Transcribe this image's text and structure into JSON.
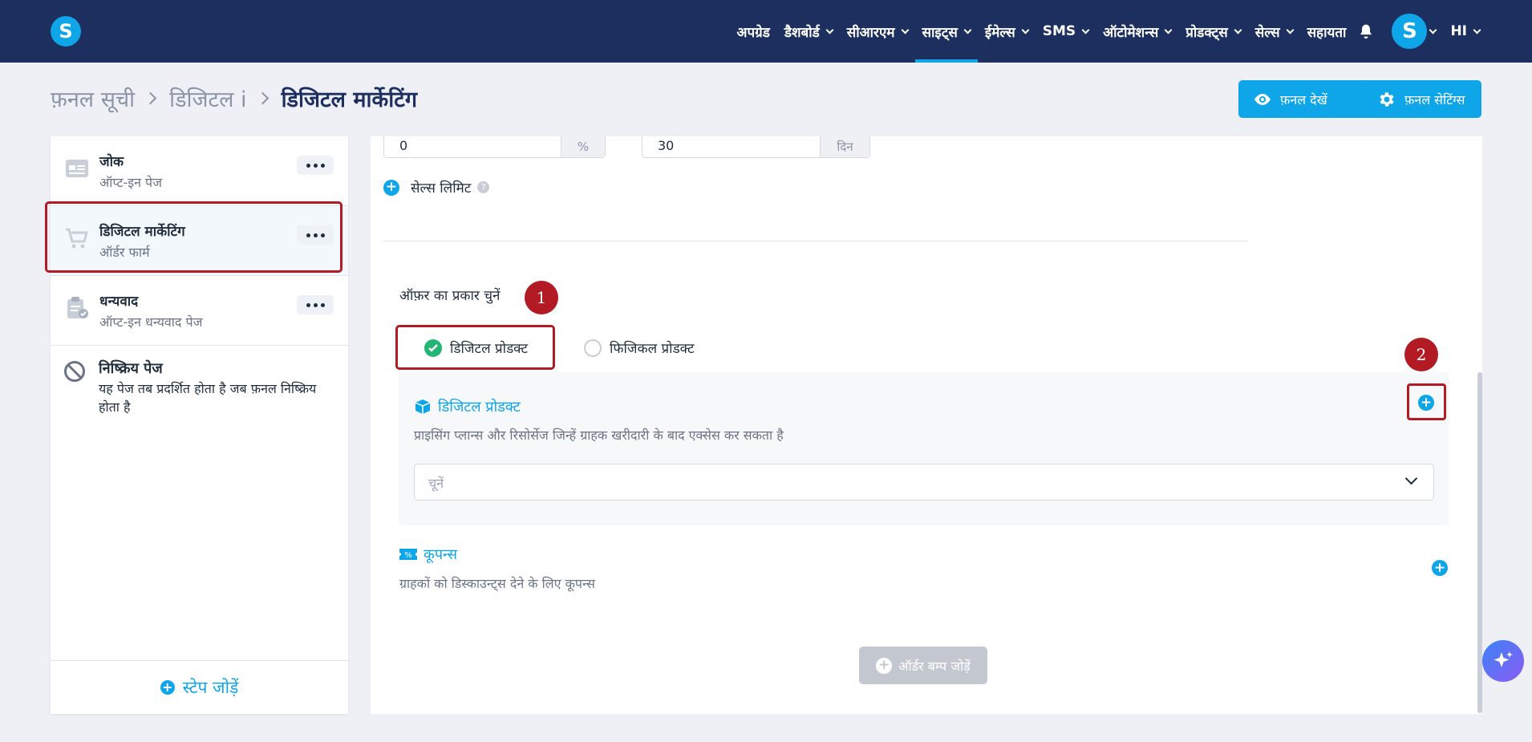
{
  "app": {
    "logo_letter": "S",
    "brand_color": "#0ea5e9",
    "nav_bg": "#1d2f5e"
  },
  "nav": {
    "items": [
      {
        "label": "अपग्रेड",
        "dropdown": false
      },
      {
        "label": "डैशबोर्ड",
        "dropdown": true
      },
      {
        "label": "सीआरएम",
        "dropdown": true
      },
      {
        "label": "साइट्स",
        "dropdown": true,
        "active": true
      },
      {
        "label": "ईमेल्स",
        "dropdown": true
      },
      {
        "label": "SMS",
        "dropdown": true
      },
      {
        "label": "ऑटोमेशन्स",
        "dropdown": true
      },
      {
        "label": "प्रोडक्ट्स",
        "dropdown": true
      },
      {
        "label": "सेल्स",
        "dropdown": true
      },
      {
        "label": "सहायता",
        "dropdown": false
      }
    ],
    "avatar_letter": "S",
    "language": "HI"
  },
  "breadcrumb": {
    "root": "फ़नल सूची",
    "middle": "डिजिटल i",
    "current": "डिजिटल मार्केटिंग"
  },
  "header_buttons": {
    "view_funnel": "फ़नल देखें",
    "funnel_settings": "फ़नल सेटिंग्स"
  },
  "sidebar": {
    "steps": [
      {
        "title": "जोक",
        "subtitle": "ऑप्ट-इन पेज",
        "icon": "optin-page-icon"
      },
      {
        "title": "डिजिटल मार्केटिंग",
        "subtitle": "ऑर्डर फार्म",
        "icon": "cart-icon",
        "selected": true
      },
      {
        "title": "धन्यवाद",
        "subtitle": "ऑप्ट-इन धन्यवाद पेज",
        "icon": "clipboard-check-icon"
      }
    ],
    "inactive_title": "निष्क्रिय पेज",
    "inactive_desc": "यह पेज तब प्रदर्शित होता है जब फ़नल निष्क्रिय होता है",
    "add_step": "स्टेप जोड़ें"
  },
  "main": {
    "field1": {
      "value": "0",
      "addon": "%"
    },
    "field2": {
      "value": "30",
      "addon": "दिन"
    },
    "sales_limit": "सेल्स लिमिट",
    "help_mark": "?",
    "offer_type_label": "ऑफ़र का प्रकार चुनें",
    "marker1": "1",
    "marker2": "2",
    "option_digital": "डिजिटल प्रोडक्ट",
    "option_physical": "फिजिकल प्रोडक्ट",
    "digital_section": {
      "title": "डिजिटल प्रोडक्ट",
      "description": "प्राइसिंग प्लान्स और रिसोर्सेज जिन्हें ग्राहक खरीदारी के बाद एक्सेस कर सकता है",
      "placeholder": "चूनें"
    },
    "coupons": {
      "title": "कूपन्स",
      "description": "ग्राहकों को डिस्काउन्ट्स देने के लिए कूपन्स"
    },
    "order_bump": "ऑर्डर बम्प जोड़ें",
    "plus": "+"
  },
  "colors": {
    "highlight_red": "#b31b24",
    "success_green": "#22b573"
  }
}
